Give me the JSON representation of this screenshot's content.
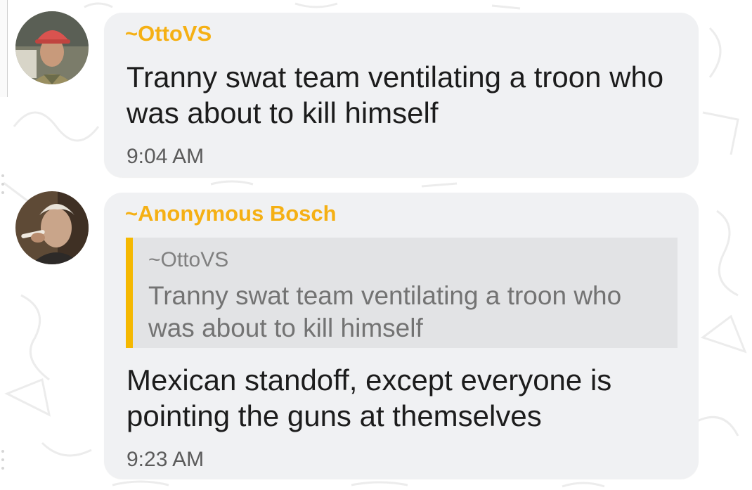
{
  "chat": {
    "messages": [
      {
        "sender": "~OttoVS",
        "text": "Tranny swat team ventilating a troon who was about to kill himself",
        "time": "9:04 AM"
      },
      {
        "sender": "~Anonymous Bosch",
        "reply_to": {
          "sender": "~OttoVS",
          "text": "Tranny swat team ventilating a troon who was about to kill himself"
        },
        "text": "Mexican standoff, except everyone is pointing the guns at themselves",
        "time": "9:23 AM"
      }
    ]
  },
  "colors": {
    "sender_name": "#f5b014",
    "quote_bar": "#f5b800",
    "bubble_bg": "#f0f1f3",
    "quote_bg": "#e2e3e5"
  },
  "icons": {
    "avatar_1": "avatar-photo",
    "avatar_2": "avatar-photo"
  }
}
